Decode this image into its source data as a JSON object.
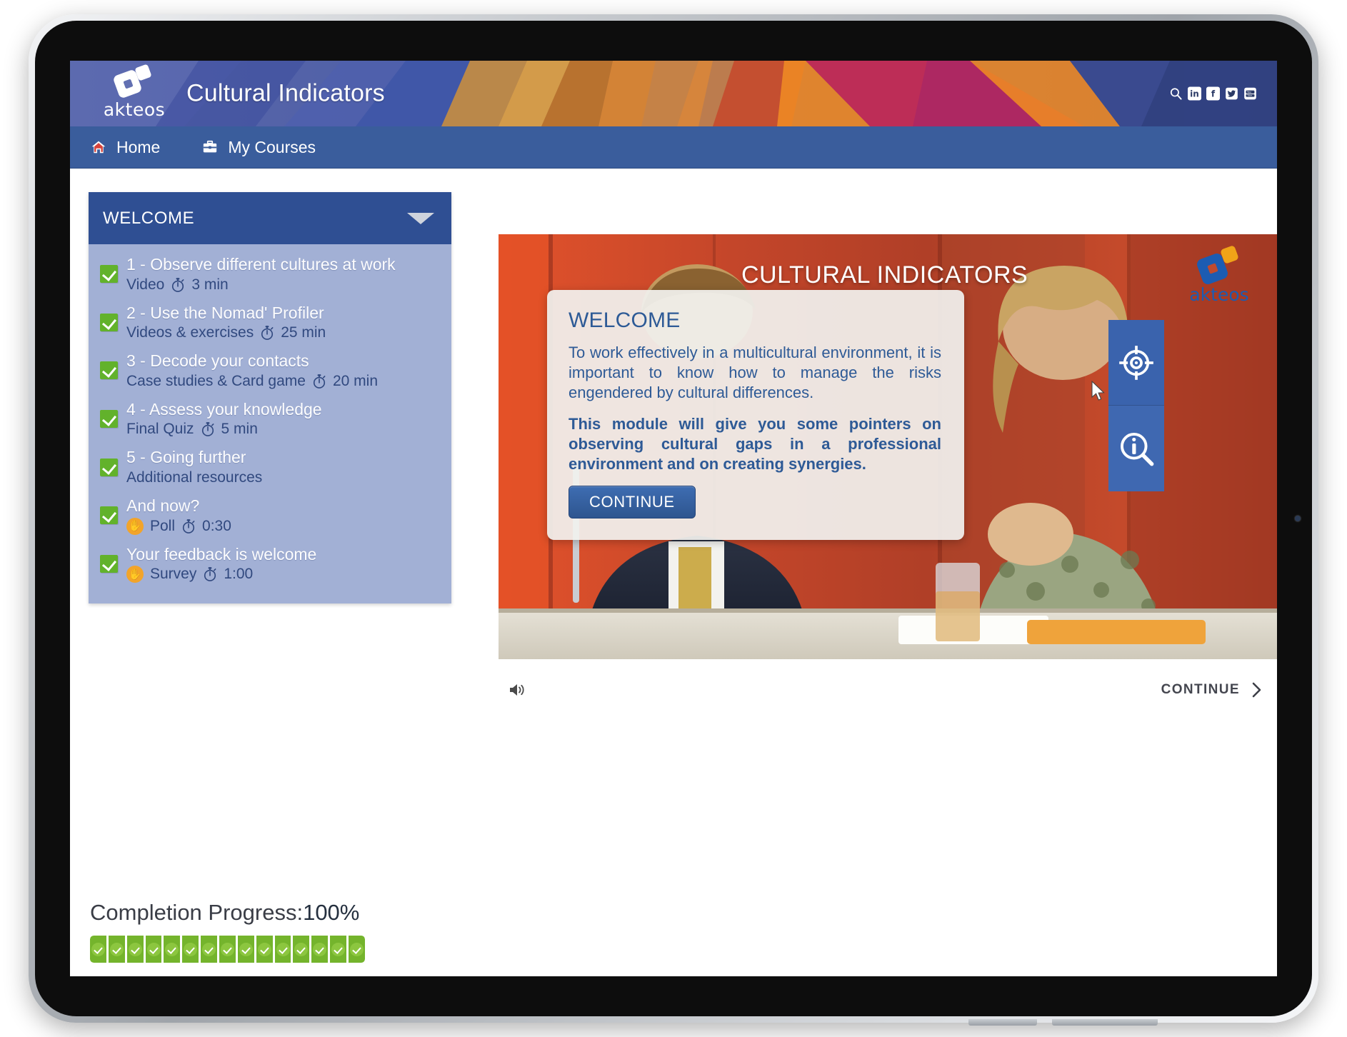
{
  "header": {
    "brand_word": "akteos",
    "title": "Cultural Indicators",
    "icons": [
      {
        "name": "search-icon",
        "label": "Q"
      },
      {
        "name": "linkedin-icon",
        "label": "in"
      },
      {
        "name": "facebook-icon",
        "label": "f"
      },
      {
        "name": "twitter-icon",
        "label": "t"
      },
      {
        "name": "youtube-icon",
        "label": "You"
      }
    ]
  },
  "nav": {
    "items": [
      {
        "label": "Home",
        "icon": "home-icon"
      },
      {
        "label": "My Courses",
        "icon": "briefcase-icon"
      }
    ]
  },
  "sidebar": {
    "section_title": "WELCOME",
    "items": [
      {
        "title": "1 - Observe different cultures at work",
        "type": "Video",
        "duration": "3 min",
        "completed": true,
        "kind_icon": null
      },
      {
        "title": "2 - Use the Nomad' Profiler",
        "type": "Videos & exercises",
        "duration": "25 min",
        "completed": true,
        "kind_icon": null
      },
      {
        "title": "3 - Decode your contacts",
        "type": "Case studies & Card game",
        "duration": "20 min",
        "completed": true,
        "kind_icon": null
      },
      {
        "title": "4 - Assess your knowledge",
        "type": "Final Quiz",
        "duration": "5 min",
        "completed": true,
        "kind_icon": null
      },
      {
        "title": "5 - Going further",
        "type": "Additional resources",
        "duration": "",
        "completed": true,
        "kind_icon": null
      },
      {
        "title": "And now?",
        "type": "Poll",
        "duration": "0:30",
        "completed": true,
        "kind_icon": "hand-icon"
      },
      {
        "title": "Your feedback is welcome",
        "type": "Survey",
        "duration": "1:00",
        "completed": true,
        "kind_icon": "hand-icon"
      }
    ]
  },
  "player": {
    "video_title": "CULTURAL INDICATORS",
    "video_brand_word": "akteos",
    "tools": [
      {
        "name": "target-icon",
        "label": "Objectives"
      },
      {
        "name": "info-search-icon",
        "label": "Information"
      }
    ],
    "overlay": {
      "title": "WELCOME",
      "paragraph1": "To work effectively in a multicultural environment, it is important to know how to manage the risks engendered by cultural differences.",
      "paragraph2": "This module will give you some pointers on observing cultural gaps in a professional environment and on creating synergies.",
      "button": "CONTINUE"
    },
    "controls": {
      "volume_icon": "volume-icon",
      "continue_label": "CONTINUE"
    }
  },
  "progress": {
    "label": "Completion Progress:",
    "percent": "100%",
    "segments": 15
  },
  "colors": {
    "header_blue": "#4d5fa8",
    "nav_blue": "#3a5d9c",
    "sidebar_head": "#2f4f93",
    "sidebar_body": "#a2b0d5",
    "accent_green": "#74b42c",
    "button_blue": "#3e6db2",
    "orange": "#f2a42a"
  }
}
